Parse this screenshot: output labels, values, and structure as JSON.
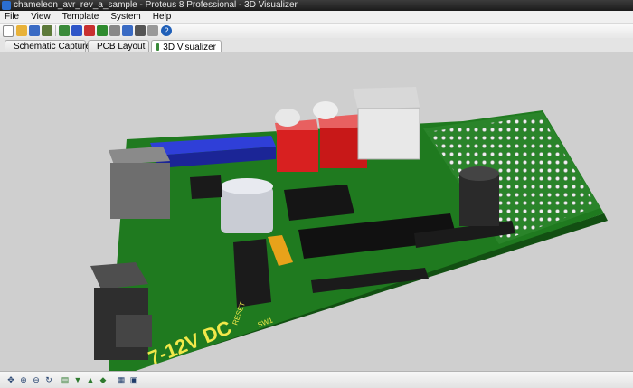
{
  "window": {
    "title": "chameleon_avr_rev_a_sample - Proteus 8 Professional - 3D Visualizer"
  },
  "menu": {
    "items": [
      "File",
      "View",
      "Template",
      "System",
      "Help"
    ]
  },
  "toolbar": {
    "buttons": [
      {
        "icon": "new-file-icon",
        "color": "#ffffff"
      },
      {
        "icon": "open-folder-icon",
        "color": "#e8b23a"
      },
      {
        "icon": "save-icon",
        "color": "#3a6bc4"
      },
      {
        "icon": "close-project-icon",
        "color": "#5d7a3a"
      },
      {
        "icon": "home-icon",
        "color": "#3a8a3a"
      },
      {
        "icon": "schematic-capture-icon",
        "color": "#2f56c8"
      },
      {
        "icon": "pcb-layout-icon",
        "color": "#c83030"
      },
      {
        "icon": "back-annotate-icon",
        "color": "#2e8b2e"
      },
      {
        "icon": "3d-visualizer-icon",
        "color": "#888888"
      },
      {
        "icon": "bill-of-materials-icon",
        "color": "#3a6bc4"
      },
      {
        "icon": "source-code-icon",
        "color": "#555555"
      },
      {
        "icon": "design-notes-icon",
        "color": "#999999"
      },
      {
        "icon": "help-icon",
        "color": "#1f5fb8"
      }
    ]
  },
  "tabs": [
    {
      "label": "Schematic Capture",
      "icon": "schematic-capture-icon",
      "color": "#2f56c8"
    },
    {
      "label": "PCB Layout",
      "icon": "pcb-layout-icon",
      "color": "#c83030"
    },
    {
      "label": "3D Visualizer",
      "icon": "3d-visualizer-icon",
      "color": "#3a8a3a"
    }
  ],
  "active_tab": "3D Visualizer",
  "board": {
    "silkscreen": [
      "7-12V DC",
      "SW1",
      "RESET"
    ],
    "colors": {
      "pcb": "#1f7a1f",
      "silkscreen": "#f1e84a",
      "background": "#cfcfcf"
    }
  },
  "bottom_toolbar": {
    "buttons": [
      {
        "icon": "pan-icon"
      },
      {
        "icon": "zoom-in-icon"
      },
      {
        "icon": "zoom-out-icon"
      },
      {
        "icon": "rotate-icon"
      },
      {
        "icon": "view-top-icon"
      },
      {
        "icon": "view-front-icon"
      },
      {
        "icon": "view-side-icon"
      },
      {
        "icon": "view-iso-icon"
      },
      {
        "icon": "fit-view-icon"
      },
      {
        "icon": "board-view-icon"
      }
    ]
  }
}
